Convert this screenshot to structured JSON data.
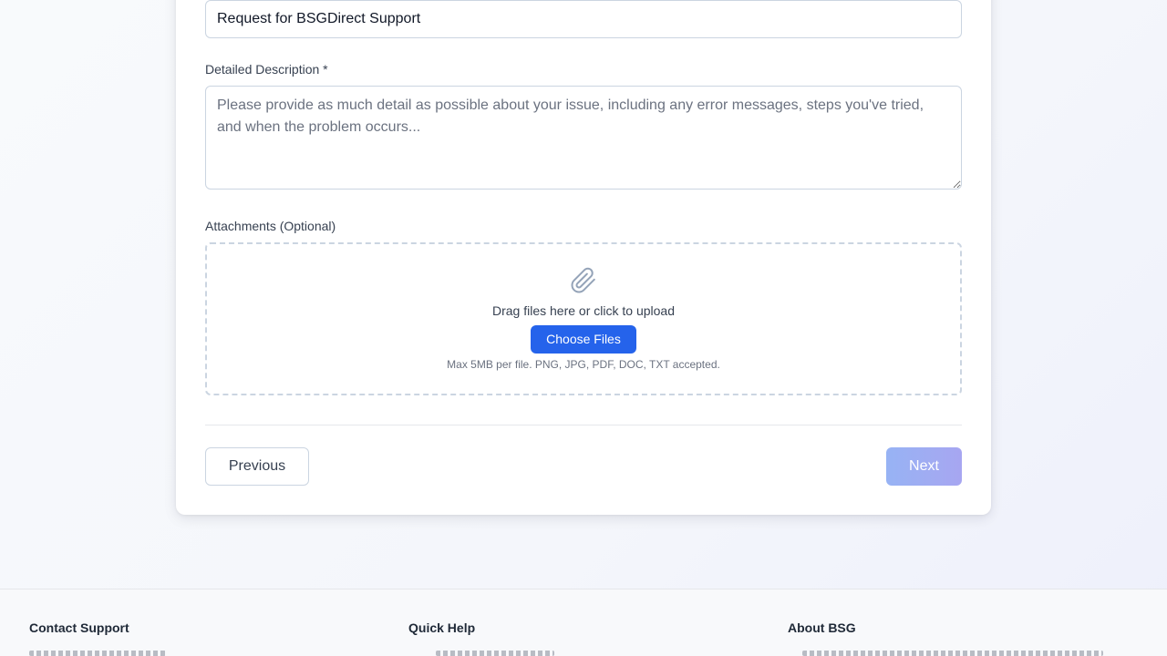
{
  "form": {
    "subject_value": "Request for BSGDirect Support",
    "description_label": "Detailed Description *",
    "description_placeholder": "Please provide as much detail as possible about your issue, including any error messages, steps you've tried, and when the problem occurs...",
    "attachments_label": "Attachments (Optional)",
    "dropzone_icon": "paperclip-icon",
    "dropzone_text": "Drag files here or click to upload",
    "choose_files_label": "Choose Files",
    "file_hint": "Max 5MB per file. PNG, JPG, PDF, DOC, TXT accepted."
  },
  "navigation": {
    "previous_label": "Previous",
    "next_label": "Next"
  },
  "footer": {
    "columns": [
      {
        "title": "Contact Support"
      },
      {
        "title": "Quick Help"
      },
      {
        "title": "About BSG"
      }
    ]
  },
  "colors": {
    "primary": "#2563eb",
    "next_disabled_start": "#97b3f4",
    "next_disabled_end": "#a7a6f1",
    "border": "#cbd5e1"
  }
}
